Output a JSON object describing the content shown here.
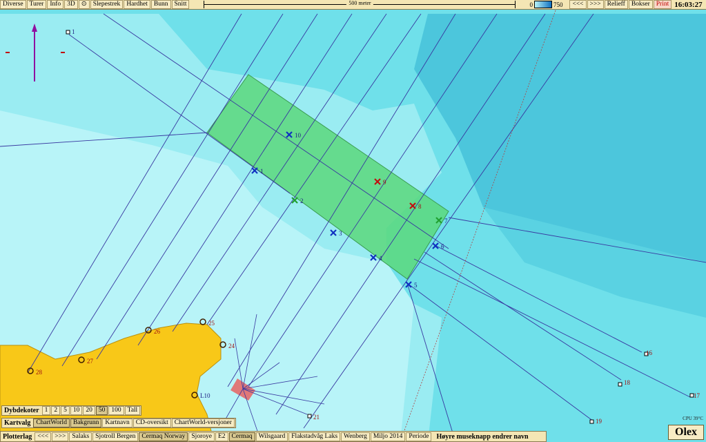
{
  "toolbar": {
    "left": [
      "Diverse",
      "Turer",
      "Info",
      "3D"
    ],
    "left2": [
      "Slepestrek",
      "Hardhet",
      "Bunn",
      "Snitt"
    ],
    "scale_label": "500 meter",
    "depth_min": "0",
    "depth_max": "750",
    "right": [
      "<<<",
      ">>>",
      "Relieff",
      "Bokser"
    ],
    "print": "Print",
    "clock": "16:03:27"
  },
  "dybdekoter": {
    "label": "Dybdekoter",
    "items": [
      "1",
      "2",
      "5",
      "10",
      "20",
      "50",
      "100",
      "Tall"
    ],
    "active": "50"
  },
  "kartvalg": {
    "label": "Kartvalg",
    "items": [
      "ChartWorld",
      "Bakgrunn",
      "Kartnavn",
      "CD-oversikt",
      "ChartWorld-versjoner"
    ]
  },
  "plotterlag": {
    "label": "Plotterlag",
    "items": [
      "<<<",
      ">>>",
      "Salaks",
      "Sjotroll Bergen",
      "Cermaq Norway",
      "Sjoroye",
      "E2",
      "Cermaq",
      "Wilsgaard",
      "Flakstadvåg Laks",
      "Wenberg",
      "Miljo 2014",
      "Periode"
    ],
    "hint": "Høyre museknapp endrer navn"
  },
  "status": {
    "cpu": "CPU 39°C",
    "brand": "Olex"
  },
  "colors": {
    "shallow": "#b8f4f8",
    "mid": "#6fe0ea",
    "deep": "#4cc6dc",
    "land": "#f8c818",
    "box": "#5cd87c"
  },
  "waypoints": [
    {
      "label": "1",
      "color": "blue"
    },
    {
      "label": "2",
      "color": "green"
    },
    {
      "label": "3",
      "color": "blue"
    },
    {
      "label": "4",
      "color": "blue"
    },
    {
      "label": "5",
      "color": "blue"
    },
    {
      "label": "6",
      "color": "blue"
    },
    {
      "label": "7",
      "color": "green"
    },
    {
      "label": "8",
      "color": "red"
    },
    {
      "label": "9",
      "color": "red"
    },
    {
      "label": "10",
      "color": "blue"
    }
  ],
  "marks": [
    "1",
    "16",
    "17",
    "18",
    "19",
    "21",
    "24",
    "25",
    "26",
    "27",
    "28",
    "L10"
  ]
}
